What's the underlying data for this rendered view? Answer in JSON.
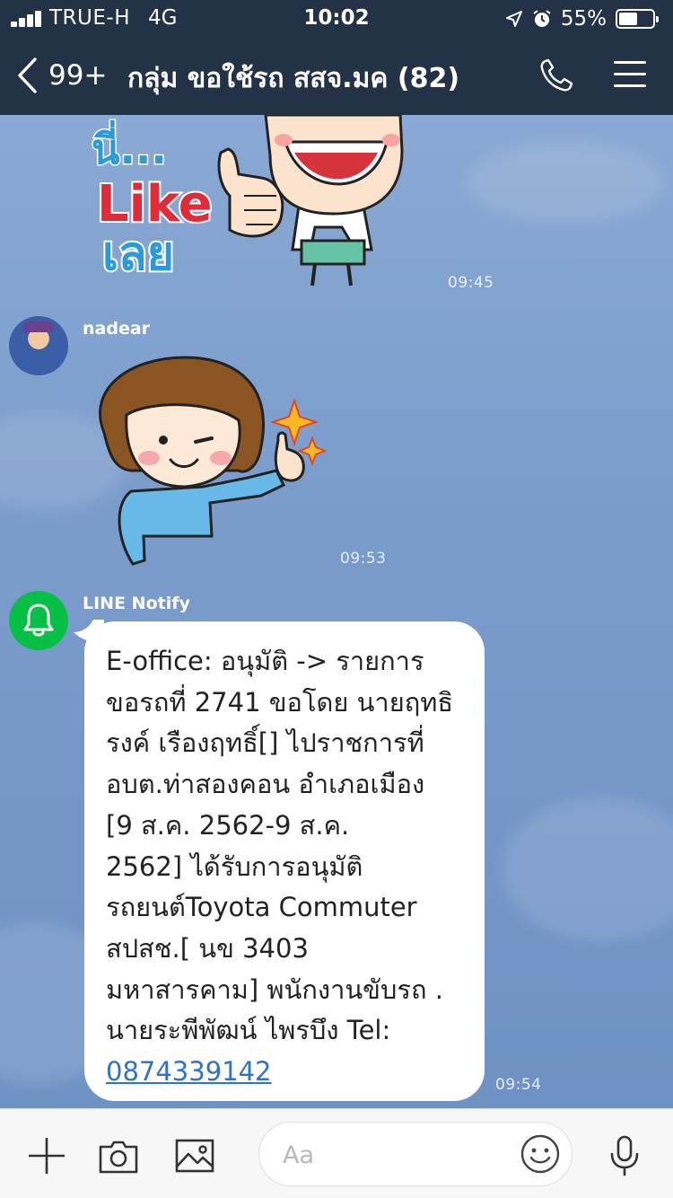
{
  "status_bar": {
    "carrier": "TRUE-H",
    "network": "4G",
    "time": "10:02",
    "battery_percent": "55%",
    "battery_level": 0.55
  },
  "header": {
    "back_count": "99+",
    "title": "กลุ่ม ขอใช้รถ สสจ.มค (82)"
  },
  "messages": [
    {
      "type": "sticker",
      "sticker_text": [
        "นี่...",
        "Like",
        "เลย"
      ],
      "time": "09:45"
    },
    {
      "type": "sticker",
      "sender": "nadear",
      "time": "09:53"
    },
    {
      "type": "text",
      "sender": "LINE Notify",
      "lines": [
        "E-office: อนุมัติ -> รายการ",
        "ขอรถที่ 2741 ขอโดย นายฤทธิ",
        "รงค์ เรืองฤทธิ์[] ไปราชการที่",
        "อบต.ท่าสองคอน อำเภอเมือง",
        "[9  ส.ค.  2562-9  ส.ค.",
        "2562] ได้รับการอนุมัติ",
        "รถยนต์Toyota Commuter",
        "สปสช.[ นข 3403",
        "มหาสารคาม] พนักงานขับรถ .",
        "นายระพีพัฒน์ ไพรบึง Tel:"
      ],
      "phone": "0874339142",
      "time": "09:54"
    }
  ],
  "input_bar": {
    "placeholder": "Aa"
  },
  "colors": {
    "header_bg": "#243247",
    "link": "#2d73c9",
    "line_green": "#06c046"
  },
  "icons": [
    "chevron-left-icon",
    "phone-icon",
    "menu-icon",
    "plus-icon",
    "camera-icon",
    "image-icon",
    "emoji-icon",
    "microphone-icon",
    "bell-icon",
    "location-arrow-icon",
    "alarm-icon"
  ]
}
